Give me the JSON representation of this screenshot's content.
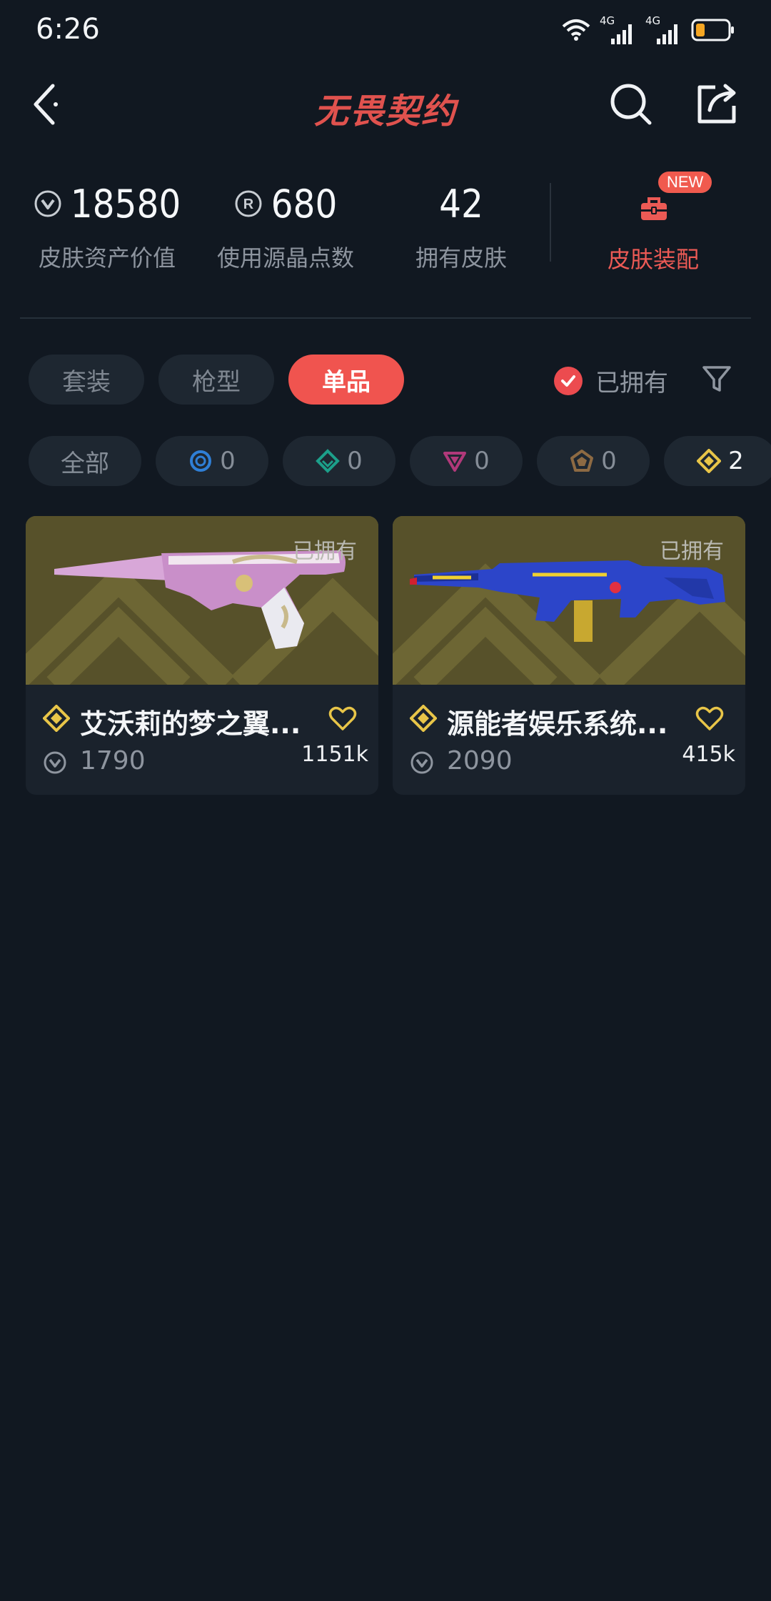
{
  "status_bar": {
    "time": "6:26",
    "network": [
      "4G",
      "4G"
    ]
  },
  "header": {
    "title": "无畏契约",
    "icons": [
      "back-icon",
      "search-icon",
      "share-icon"
    ]
  },
  "stats": {
    "asset_value": {
      "value": "18580",
      "label": "皮肤资产价值",
      "icon": "vp-coin-icon"
    },
    "radianite_points": {
      "value": "680",
      "label": "使用源晶点数",
      "icon": "radianite-icon"
    },
    "owned_skins": {
      "value": "42",
      "label": "拥有皮肤"
    },
    "equip": {
      "label": "皮肤装配",
      "badge": "NEW",
      "icon": "briefcase-icon"
    }
  },
  "tabs": [
    {
      "label": "套装",
      "active": false
    },
    {
      "label": "枪型",
      "active": false
    },
    {
      "label": "单品",
      "active": true
    }
  ],
  "owned_filter": {
    "label": "已拥有",
    "checked": true
  },
  "rarity_chips": [
    {
      "label": "全部"
    },
    {
      "icon": "select-tier-icon",
      "count": "0",
      "color": "#2f7fd6"
    },
    {
      "icon": "deluxe-tier-icon",
      "count": "0",
      "color": "#1c9f8a"
    },
    {
      "icon": "premium-tier-icon",
      "count": "0",
      "color": "#b1397a"
    },
    {
      "icon": "ultra-tier-icon",
      "count": "0",
      "color": "#8d6a43"
    },
    {
      "icon": "exclusive-tier-icon",
      "count": "2",
      "color": "#e8c548"
    }
  ],
  "cards": [
    {
      "name": "艾沃莉的梦之翼...",
      "owned_tag": "已拥有",
      "price": "1790",
      "count": "1151k",
      "tier_icon": "exclusive-tier-icon"
    },
    {
      "name": "源能者娱乐系统...",
      "owned_tag": "已拥有",
      "price": "2090",
      "count": "415k",
      "tier_icon": "exclusive-tier-icon"
    }
  ],
  "colors": {
    "background": "#111821",
    "accent": "#f0544f",
    "card_bg": "#1a222c",
    "exclusive_gold": "#e8c548"
  }
}
